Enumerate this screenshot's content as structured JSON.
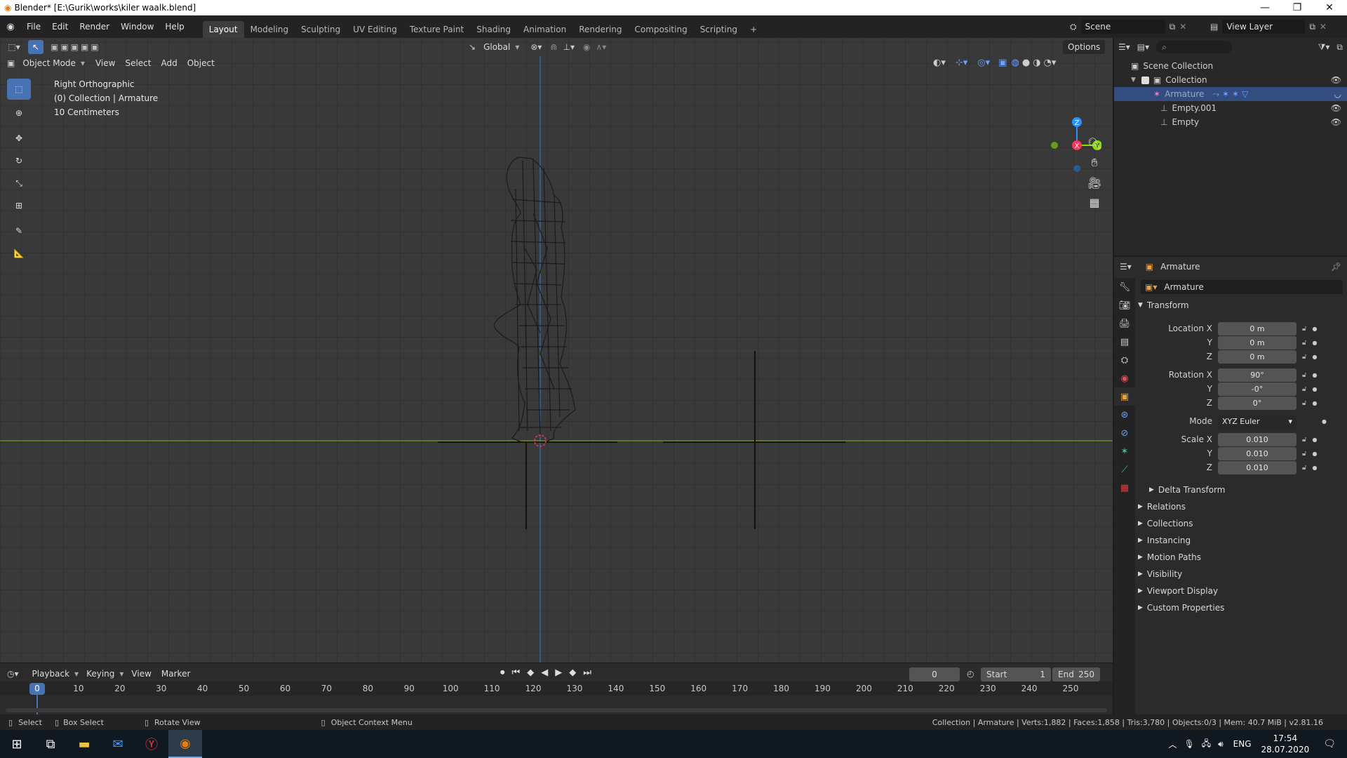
{
  "window": {
    "title": "Blender* [E:\\Gurik\\works\\kiler waalk.blend]",
    "controls": [
      "minimize-icon",
      "restore-icon",
      "close-icon"
    ]
  },
  "menu": {
    "items": [
      "File",
      "Edit",
      "Render",
      "Window",
      "Help"
    ]
  },
  "workspaces": {
    "tabs": [
      "Layout",
      "Modeling",
      "Sculpting",
      "UV Editing",
      "Texture Paint",
      "Shading",
      "Animation",
      "Rendering",
      "Compositing",
      "Scripting"
    ],
    "active": "Layout",
    "add": "+"
  },
  "scene": {
    "name": "Scene",
    "view_layer": "View Layer"
  },
  "viewport_header": {
    "mode": "Object Mode",
    "menus": [
      "View",
      "Select",
      "Add",
      "Object"
    ],
    "orientation": "Global",
    "options": "Options"
  },
  "viewport": {
    "view_name": "Right Orthographic",
    "collection_info": "(0) Collection | Armature",
    "scale_info": "10 Centimeters",
    "gizmo_axes": {
      "z": "Z",
      "x": "X",
      "y": "Y"
    }
  },
  "toolbar": {
    "tools": [
      "select-box-icon",
      "cursor-icon",
      "move-icon",
      "rotate-icon",
      "scale-icon",
      "transform-icon",
      "annotate-icon",
      "measure-icon"
    ],
    "active": "select-box-icon"
  },
  "timeline": {
    "menus": [
      "Playback",
      "Keying",
      "View",
      "Marker"
    ],
    "current_frame": "0",
    "start_label": "Start",
    "start": "1",
    "end_label": "End",
    "end": "250",
    "ticks": [
      "0",
      "10",
      "20",
      "30",
      "40",
      "50",
      "60",
      "70",
      "80",
      "90",
      "100",
      "110",
      "120",
      "130",
      "140",
      "150",
      "160",
      "170",
      "180",
      "190",
      "200",
      "210",
      "220",
      "230",
      "240",
      "250"
    ]
  },
  "status_bar": {
    "hints": [
      "Select",
      "Box Select",
      "Rotate View",
      "Object Context Menu"
    ],
    "stats": "Collection | Armature | Verts:1,882 | Faces:1,858 | Tris:3,780 | Objects:0/3 | Mem: 40.7 MiB | v2.81.16"
  },
  "outliner": {
    "root": "Scene Collection",
    "collection": "Collection",
    "items": [
      {
        "name": "Armature",
        "selected": true
      },
      {
        "name": "Empty.001",
        "selected": false
      },
      {
        "name": "Empty",
        "selected": false
      }
    ]
  },
  "properties": {
    "object_name": "Armature",
    "object_field": "Armature",
    "transform_title": "Transform",
    "location": {
      "label_x": "Location X",
      "x": "0 m",
      "label_y": "Y",
      "y": "0 m",
      "label_z": "Z",
      "z": "0 m"
    },
    "rotation": {
      "label_x": "Rotation X",
      "x": "90°",
      "label_y": "Y",
      "y": "-0°",
      "label_z": "Z",
      "z": "0°"
    },
    "mode_label": "Mode",
    "mode": "XYZ Euler",
    "scale": {
      "label_x": "Scale X",
      "x": "0.010",
      "label_y": "Y",
      "y": "0.010",
      "label_z": "Z",
      "z": "0.010"
    },
    "delta_transform": "Delta Transform",
    "panels": [
      "Relations",
      "Collections",
      "Instancing",
      "Motion Paths",
      "Visibility",
      "Viewport Display",
      "Custom Properties"
    ]
  },
  "taskbar": {
    "language": "ENG",
    "time": "17:54",
    "date": "28.07.2020"
  },
  "colors": {
    "accent": "#4772b3",
    "selection": "#334d80",
    "axis_x": "#ff3352",
    "axis_y": "#8bdc00",
    "axis_z": "#2890ff"
  }
}
